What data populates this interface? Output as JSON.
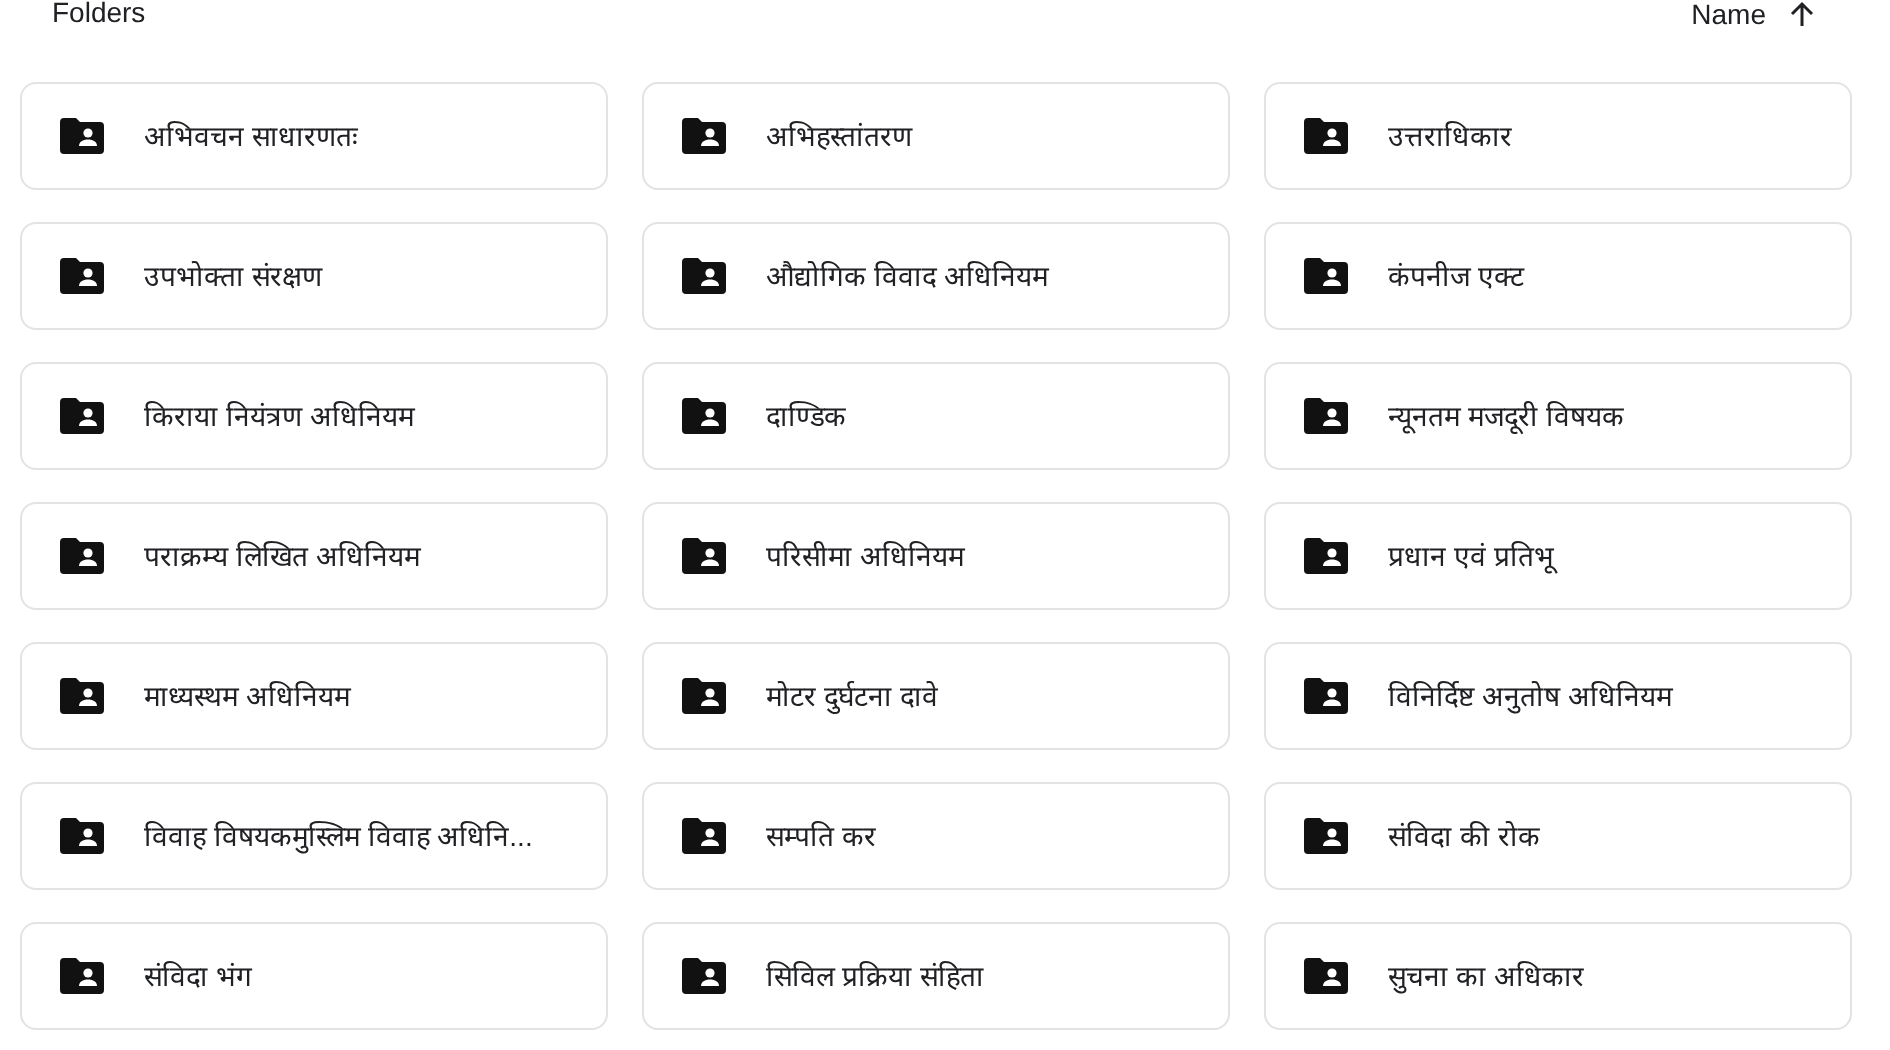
{
  "section_title": "Folders",
  "sort": {
    "label": "Name",
    "ascending": true
  },
  "folders": [
    {
      "name": "अभिवचन साधारणतः"
    },
    {
      "name": "अभिहस्तांतरण"
    },
    {
      "name": "उत्तराधिकार"
    },
    {
      "name": "उपभोक्ता संरक्षण"
    },
    {
      "name": "औद्योगिक विवाद अधिनियम"
    },
    {
      "name": "कंपनीज एक्ट"
    },
    {
      "name": "किराया नियंत्रण अधिनियम"
    },
    {
      "name": "दाण्डिक"
    },
    {
      "name": "न्यूनतम मजदूरी विषयक"
    },
    {
      "name": "पराक्रम्य लिखित अधिनियम"
    },
    {
      "name": "परिसीमा अधिनियम"
    },
    {
      "name": "प्रधान एवं प्रतिभू"
    },
    {
      "name": "माध्यस्थम अधिनियम"
    },
    {
      "name": "मोटर दुर्घटना दावे"
    },
    {
      "name": "विनिर्दिष्ट अनुतोष अधिनियम"
    },
    {
      "name": "विवाह विषयकमुस्लिम विवाह अधिनि..."
    },
    {
      "name": "सम्पति कर"
    },
    {
      "name": "संविदा की रोक"
    },
    {
      "name": "संविदा भंग"
    },
    {
      "name": "सिविल प्रक्रिया संहिता"
    },
    {
      "name": "सुचना का अधिकार"
    }
  ]
}
